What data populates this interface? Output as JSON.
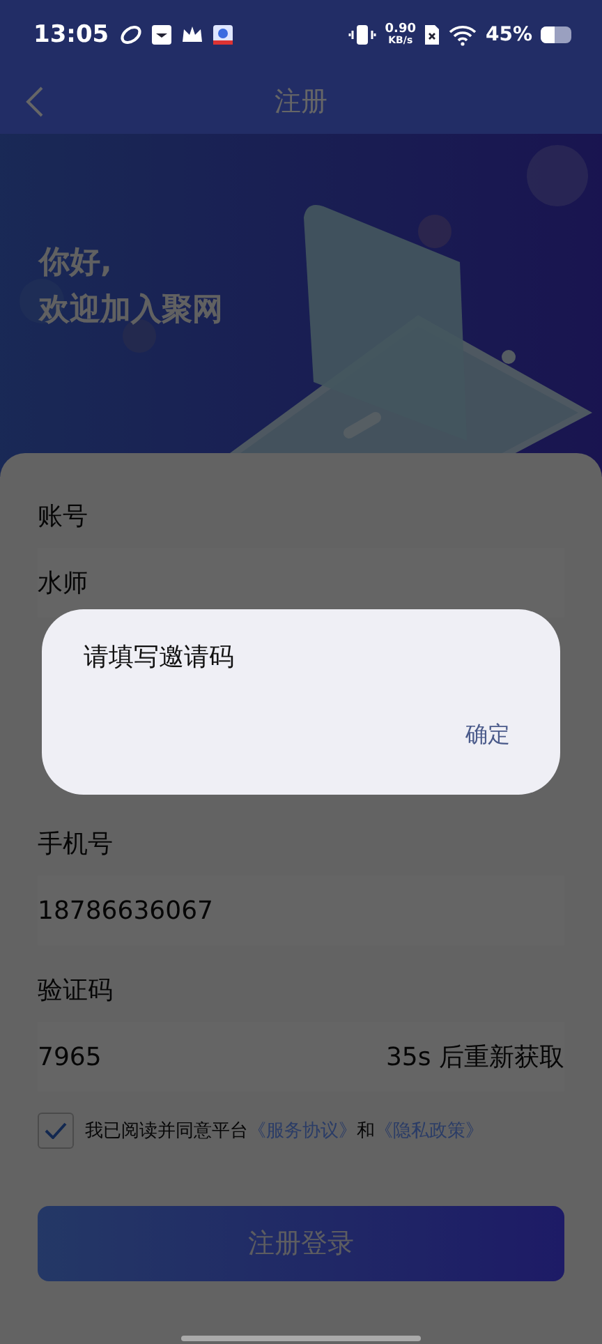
{
  "status_bar": {
    "time": "13:05",
    "net_speed": "0.90",
    "net_unit": "KB/s",
    "battery": "45%"
  },
  "nav": {
    "title": "注册"
  },
  "banner": {
    "kind": "picture",
    "greeting": "你好,",
    "welcome": "欢迎加入聚网"
  },
  "form": {
    "fields": [
      {
        "label": "账号",
        "value": "水师"
      },
      {
        "label": "手机号",
        "value": "18786636067"
      },
      {
        "label": "验证码",
        "value": "7965",
        "action": "35s 后重新获取"
      }
    ]
  },
  "agreement": {
    "checked": true,
    "text": "我已阅读并同意平台",
    "link_1": "《服务协议》",
    "conjunction": "和",
    "link_2": "《隐私政策》"
  },
  "submit_button": "注册登录",
  "dialog": {
    "message": "请填写邀请码",
    "button": "确定"
  }
}
